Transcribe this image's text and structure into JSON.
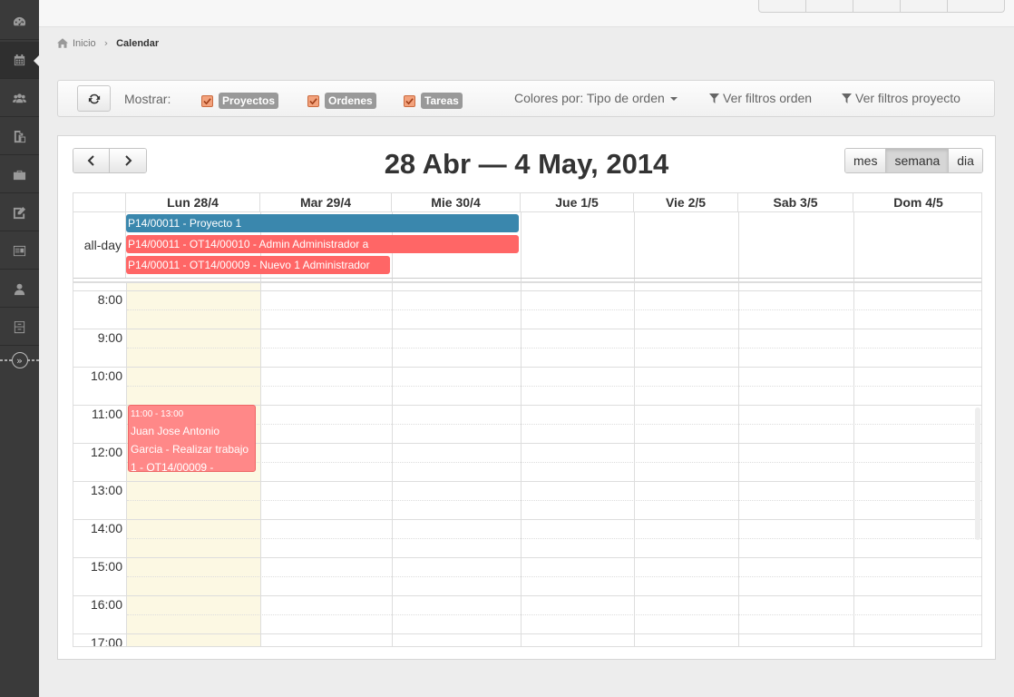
{
  "breadcrumb": {
    "home": "Inicio",
    "current": "Calendar"
  },
  "filterbar": {
    "mostrar": "Mostrar:",
    "checks": [
      {
        "label": "Proyectos",
        "checked": true
      },
      {
        "label": "Ordenes",
        "checked": true
      },
      {
        "label": "Tareas",
        "checked": true
      }
    ],
    "colores": "Colores por: Tipo de orden",
    "filter_orden": "Ver filtros orden",
    "filter_proyecto": "Ver filtros proyecto"
  },
  "calendar": {
    "title": "28 Abr — 4 May, 2014",
    "views": [
      "mes",
      "semana",
      "dia"
    ],
    "active_view": "semana",
    "allday_label": "all-day",
    "days": [
      "Lun 28/4",
      "Mar 29/4",
      "Mie 30/4",
      "Jue 1/5",
      "Vie 2/5",
      "Sab 3/5",
      "Dom 4/5"
    ],
    "today_index": 0,
    "allday_events": [
      {
        "text": "P14/00011 - Proyecto 1",
        "color": "#3a87ad"
      },
      {
        "text": "P14/00011 - OT14/00010 - Admin Administrador a",
        "color": "#ff6666"
      },
      {
        "text": "P14/00011 - OT14/00009 - Nuevo 1 Administrador",
        "color": "#ff6666"
      }
    ],
    "hours": [
      "8:00",
      "9:00",
      "10:00",
      "11:00",
      "12:00",
      "13:00",
      "14:00",
      "15:00",
      "16:00",
      "17:00"
    ],
    "timed_event": {
      "time": "11:00 - 13:00",
      "title": "Juan Jose Antonio Garcia - Realizar trabajo 1 - OT14/00009 -",
      "color": "#ff8888"
    }
  },
  "icons": {
    "sidebar": [
      "dashboard-icon",
      "calendar-icon",
      "users-icon",
      "documents-icon",
      "briefcase-icon",
      "edit-icon",
      "report-icon",
      "user-icon",
      "archive-icon"
    ],
    "collapse": "double-chevron-right-icon",
    "refresh": "refresh-icon",
    "home": "home-icon",
    "filter": "filter-icon"
  }
}
